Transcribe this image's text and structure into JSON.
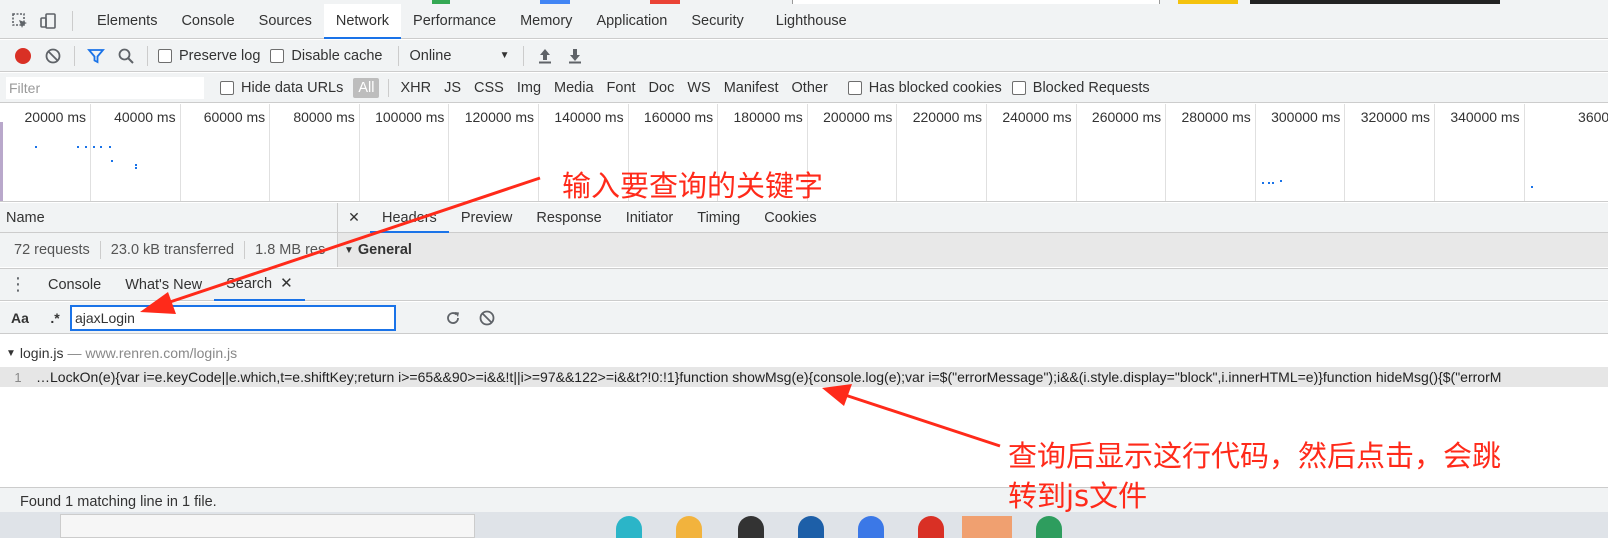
{
  "devtools": {
    "tabs": [
      "Elements",
      "Console",
      "Sources",
      "Network",
      "Performance",
      "Memory",
      "Application",
      "Security",
      "Lighthouse"
    ],
    "active_tab": "Network"
  },
  "network_toolbar": {
    "preserve_log": "Preserve log",
    "disable_cache": "Disable cache",
    "throttle": "Online"
  },
  "filter_bar": {
    "placeholder": "Filter",
    "hide_data_urls": "Hide data URLs",
    "types": [
      "All",
      "XHR",
      "JS",
      "CSS",
      "Img",
      "Media",
      "Font",
      "Doc",
      "WS",
      "Manifest",
      "Other"
    ],
    "selected_type": "All",
    "has_blocked_cookies": "Has blocked cookies",
    "blocked_requests": "Blocked Requests"
  },
  "overview": {
    "ticks": [
      "20000 ms",
      "40000 ms",
      "60000 ms",
      "80000 ms",
      "100000 ms",
      "120000 ms",
      "140000 ms",
      "160000 ms",
      "180000 ms",
      "200000 ms",
      "220000 ms",
      "240000 ms",
      "260000 ms",
      "280000 ms",
      "300000 ms",
      "320000 ms",
      "340000 ms",
      "3600"
    ]
  },
  "requests": {
    "name_header": "Name",
    "count": "72 requests",
    "transferred": "23.0 kB transferred",
    "resources": "1.8 MB res"
  },
  "detail": {
    "close": "✕",
    "tabs": [
      "Headers",
      "Preview",
      "Response",
      "Initiator",
      "Timing",
      "Cookies"
    ],
    "active_tab": "Headers",
    "section": "General"
  },
  "drawer": {
    "tabs": [
      "Console",
      "What's New",
      "Search"
    ],
    "active_tab": "Search",
    "close": "✕"
  },
  "search": {
    "case_label": "Aa",
    "regex_label": ".*",
    "query": "ajaxLogin"
  },
  "results": {
    "file": "login.js",
    "url": "— www.renren.com/login.js",
    "line_number": "1",
    "line_text": "…LockOn(e){var i=e.keyCode||e.which,t=e.shiftKey;return i>=65&&90>=i&&!t||i>=97&&122>=i&&t?!0:!1}function showMsg(e){console.log(e);var i=$(\"errorMessage\");i&&(i.style.display=\"block\",i.innerHTML=e)}function hideMsg(){$(\"errorM",
    "status": "Found 1 matching line in 1 file."
  },
  "annotations": {
    "top": "输入要查询的关键字",
    "bottom_line1": "查询后显示这行代码，然后点击，会跳",
    "bottom_line2": "转到js文件"
  },
  "colors": {
    "accent": "#1a73e8",
    "record": "#d93025",
    "annotation": "#ff2a1a"
  }
}
